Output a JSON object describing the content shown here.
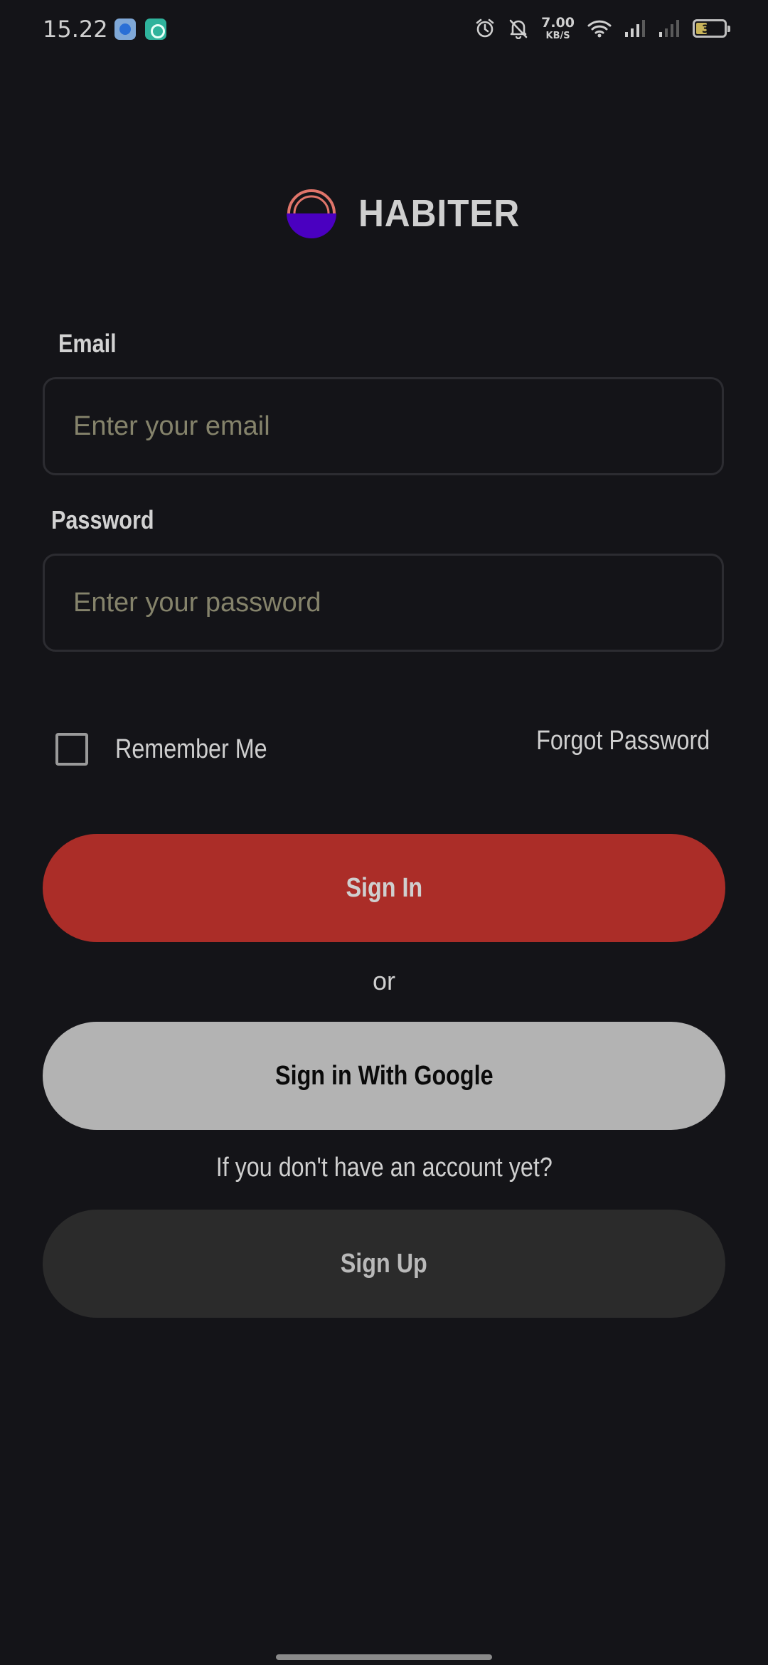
{
  "status_bar": {
    "time": "15.22",
    "net_speed_value": "7.00",
    "net_speed_unit": "KB/S",
    "battery": "39",
    "icons": [
      "app-blue-icon",
      "app-teal-icon",
      "alarm-icon",
      "bell-off-icon",
      "wifi-icon",
      "signal-icon",
      "signal-weak-icon",
      "battery-icon"
    ]
  },
  "brand": {
    "name": "HABITER",
    "colors": {
      "arc": "#e0756a",
      "bowl": "#4a00c0"
    }
  },
  "form": {
    "email_label": "Email",
    "email_placeholder": "Enter your email",
    "email_value": "",
    "password_label": "Password",
    "password_placeholder": "Enter your password",
    "password_value": "",
    "remember_label": "Remember Me",
    "remember_checked": false,
    "forgot_label": "Forgot Password"
  },
  "actions": {
    "sign_in": "Sign In",
    "or": "or",
    "google": "Sign in With Google",
    "no_account": "If you don't have an account yet?",
    "sign_up": "Sign Up"
  },
  "colors": {
    "background": "#141418",
    "sign_in_button": "#ab2d28",
    "google_button": "#b3b3b3",
    "sign_up_button": "#2b2b2b",
    "placeholder": "#85836b"
  }
}
